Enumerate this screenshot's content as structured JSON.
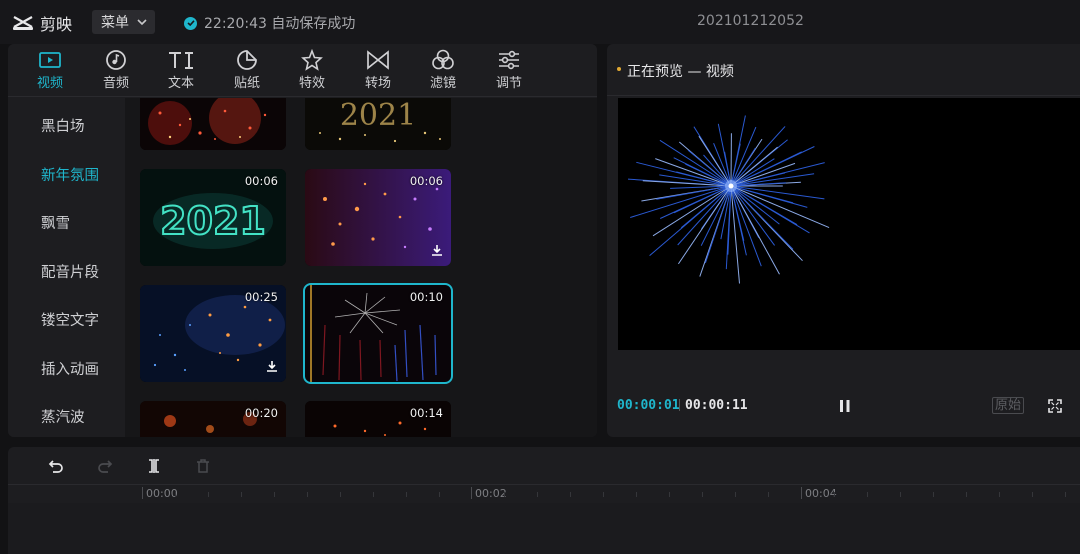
{
  "app": {
    "name": "剪映"
  },
  "topbar": {
    "menu_label": "菜单",
    "save_status": "22:20:43 自动保存成功",
    "project_name": "202101212052"
  },
  "tabs": [
    {
      "label": "视频",
      "icon": "video-icon",
      "active": true
    },
    {
      "label": "音频",
      "icon": "audio-icon"
    },
    {
      "label": "文本",
      "icon": "text-icon"
    },
    {
      "label": "贴纸",
      "icon": "sticker-icon"
    },
    {
      "label": "特效",
      "icon": "effects-icon"
    },
    {
      "label": "转场",
      "icon": "transition-icon"
    },
    {
      "label": "滤镜",
      "icon": "filter-icon"
    },
    {
      "label": "调节",
      "icon": "adjust-icon"
    }
  ],
  "categories": [
    {
      "label": "黑白场"
    },
    {
      "label": "新年氛围",
      "active": true
    },
    {
      "label": "飘雪"
    },
    {
      "label": "配音片段"
    },
    {
      "label": "镂空文字"
    },
    {
      "label": "插入动画"
    },
    {
      "label": "蒸汽波"
    }
  ],
  "clips": [
    {
      "name": "red-fireworks",
      "duration": ""
    },
    {
      "name": "gold-2021",
      "duration": ""
    },
    {
      "name": "neon-2021",
      "duration": "00:06"
    },
    {
      "name": "purple-bokeh",
      "duration": "00:06",
      "downloadable": true
    },
    {
      "name": "blue-orange-particles",
      "duration": "00:25",
      "downloadable": true
    },
    {
      "name": "firework-burst",
      "duration": "00:10",
      "selected": true
    },
    {
      "name": "orange-bokeh",
      "duration": "00:20"
    },
    {
      "name": "spark-rain",
      "duration": "00:14"
    }
  ],
  "preview": {
    "title": "正在预览 — 视频",
    "current_time": "00:00:01",
    "total_time": "00:00:11",
    "ratio_label": "原始"
  },
  "timeline": {
    "ticks": [
      "00:00",
      "00:02",
      "00:04"
    ]
  },
  "colors": {
    "accent": "#1fb6cc",
    "panel": "#1d1d20",
    "background": "#121214"
  }
}
